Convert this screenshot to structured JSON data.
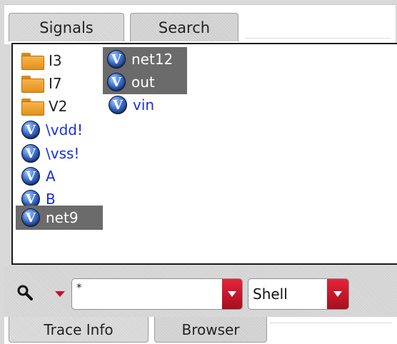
{
  "tabs_top": [
    {
      "label": "Signals",
      "active": true
    },
    {
      "label": "Search",
      "active": false
    }
  ],
  "signals": {
    "column1": [
      {
        "label": "I3",
        "type": "folder",
        "selected": false
      },
      {
        "label": "I7",
        "type": "folder",
        "selected": false
      },
      {
        "label": "V2",
        "type": "folder",
        "selected": false
      },
      {
        "label": "\\vdd!",
        "type": "signal",
        "selected": false
      },
      {
        "label": "\\vss!",
        "type": "signal",
        "selected": false
      },
      {
        "label": "A",
        "type": "signal",
        "selected": false
      },
      {
        "label": "B",
        "type": "signal",
        "selected": false
      },
      {
        "label": "net9",
        "type": "signal",
        "selected": true
      }
    ],
    "column2": [
      {
        "label": "net12",
        "type": "signal",
        "selected": true
      },
      {
        "label": "out",
        "type": "signal",
        "selected": true
      },
      {
        "label": "vin",
        "type": "signal",
        "selected": false
      }
    ],
    "signal_icon_letter": "V"
  },
  "toolbar": {
    "search_icon": "search-icon",
    "filter_value": "*",
    "shell_value": "Shell"
  },
  "tabs_bottom": [
    {
      "label": "Trace Info",
      "active": true
    },
    {
      "label": "Browser",
      "active": false
    }
  ],
  "colors": {
    "signal_text": "#1a2fd8",
    "selection_bg": "#6b6b6b",
    "accent_red": "#c8102e"
  }
}
